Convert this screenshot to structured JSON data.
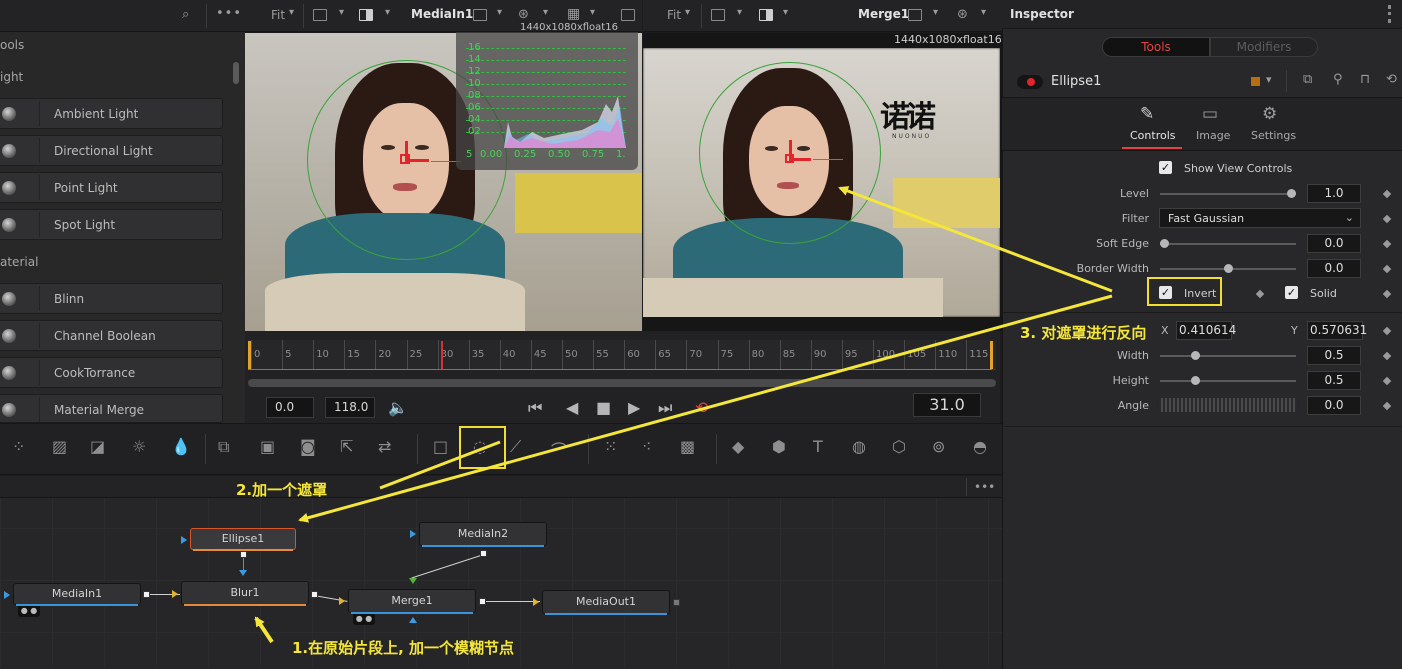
{
  "library": {
    "top_label": "ools",
    "sections": [
      {
        "title": "ight",
        "items": [
          "Ambient Light",
          "Directional Light",
          "Point Light",
          "Spot Light"
        ]
      },
      {
        "title": "aterial",
        "items": [
          "Blinn",
          "Channel Boolean",
          "CookTorrance",
          "Material Merge"
        ]
      }
    ]
  },
  "viewer1": {
    "fit_label": "Fit",
    "name": "MediaIn1",
    "resolution": "1440x1080xfloat16"
  },
  "viewer2": {
    "fit_label": "Fit",
    "name": "Merge1",
    "resolution": "1440x1080xfloat16"
  },
  "histogram": {
    "y_labels": [
      "16",
      "14",
      "12",
      "10",
      "08",
      "06",
      "04",
      "02"
    ],
    "x_labels": [
      "0.00",
      "0.25",
      "0.50",
      "0.75",
      "1."
    ]
  },
  "watermark": {
    "text": "诺诺",
    "sub": "NUONUO"
  },
  "timeline": {
    "ticks": [
      "0",
      "5",
      "10",
      "15",
      "20",
      "25",
      "30",
      "35",
      "40",
      "45",
      "50",
      "55",
      "60",
      "65",
      "70",
      "75",
      "80",
      "85",
      "90",
      "95",
      "100",
      "105",
      "110",
      "115"
    ],
    "start": "0.0",
    "end": "118.0",
    "current": "31.0"
  },
  "nodes": {
    "ellipse": "Ellipse1",
    "mediain1": "MediaIn1",
    "blur": "Blur1",
    "mediain2": "MediaIn2",
    "merge": "Merge1",
    "mediaout": "MediaOut1"
  },
  "inspector": {
    "title": "Inspector",
    "tabs": [
      "Tools",
      "Modifiers"
    ],
    "tool_name": "Ellipse1",
    "subtabs": [
      "Controls",
      "Image",
      "Settings"
    ],
    "show_view_controls": "Show View Controls",
    "level": {
      "label": "Level",
      "value": "1.0"
    },
    "filter": {
      "label": "Filter",
      "value": "Fast Gaussian"
    },
    "soft_edge": {
      "label": "Soft Edge",
      "value": "0.0"
    },
    "border_width": {
      "label": "Border Width",
      "value": "0.0"
    },
    "invert": "Invert",
    "solid": "Solid",
    "center_x": {
      "label": "X",
      "value": "0.410614"
    },
    "center_y": {
      "label": "Y",
      "value": "0.570631"
    },
    "width": {
      "label": "Width",
      "value": "0.5"
    },
    "height": {
      "label": "Height",
      "value": "0.5"
    },
    "angle": {
      "label": "Angle",
      "value": "0.0"
    }
  },
  "annotations": {
    "step1": "1.在原始片段上, 加一个模糊节点",
    "step2": "2.加一个遮罩",
    "step3": "3. 对遮罩进行反向"
  },
  "colors": {
    "annotation": "#f5e63a",
    "accent_red": "#e0262a",
    "mask_green": "#3aa23a"
  }
}
